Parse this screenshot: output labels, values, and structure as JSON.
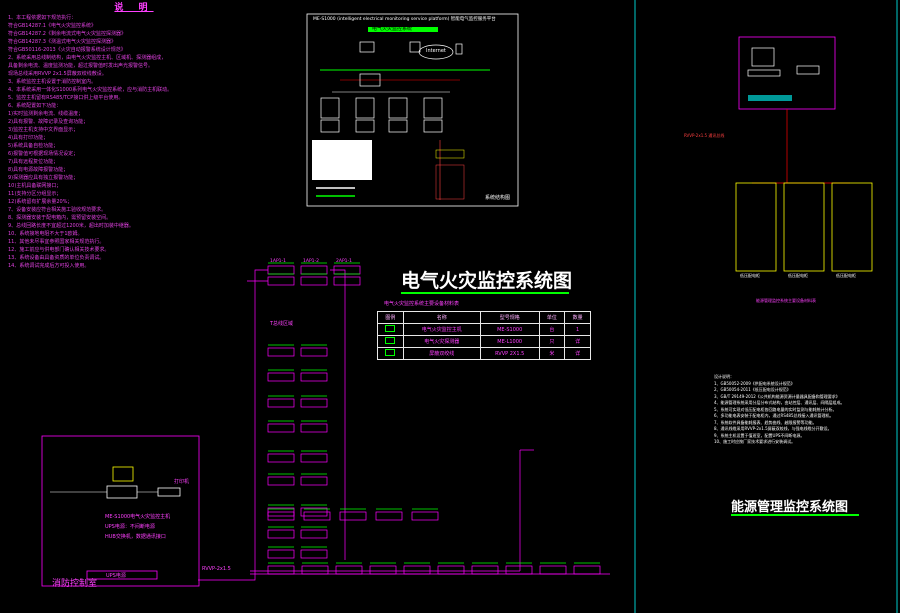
{
  "notes": {
    "title": "说 明",
    "lines": [
      "1、本工程依据如下规范执行：",
      "  符合GB14287.1《电气火灾监控系统》",
      "  符合GB14287.2《剩余电流式电气火灾监控探测器》",
      "  符合GB14287.3《测温式电气火灾监控探测器》",
      "  符合GB50116-2013《火灾自动报警系统设计规范》",
      "2、系统采用总线制结构，由电气火灾监控主机、区域机、探测器组成，",
      "  具备剩余电流、温度监测功能，超过报警值时发出声光报警信号。",
      "  现场总线采用RVVP 2x1.5屏蔽双绞线敷设。",
      "3、系统监控主机设置于消防控制室内。",
      "4、本系统采用一体化S1000系列电气火灾监控系统，应与消防主机联动。",
      "5、监控主机留有RS485/TCP接口供上级平台使用。",
      "6、系统配置如下功能：",
      "  1)实时监测剩余电流、线缆温度；",
      "  2)具有报警、故障记录及查询功能；",
      "  3)监控主机支持中文界面显示；",
      "  4)具有打印功能；",
      "  5)系统具备自检功能；",
      "  6)报警值可根据现场情况设定；",
      "  7)具有远程复位功能；",
      "  8)具有电源故障报警功能；",
      "  9)探测器应具有独立报警功能；",
      "  10)主机具备联网接口；",
      "  11)支持分区分组显示；",
      "  12)系统留有扩展余量20%；",
      "7、设备安装应符合相关施工验收规范要求。",
      "8、探测器安装于配电箱内，需预留安装空间。",
      "9、总线回路长度不宜超过1200米，超出时加装中继器。",
      "10、系统接地电阻不大于1欧姆。",
      "11、其他未尽事宜参照国家相关规范执行。",
      "12、施工前应与供电部门确认相关技术要求。",
      "13、系统设备由具备资质的单位负责调试。",
      "14、系统调试完成后方可投入使用。"
    ]
  },
  "titles": {
    "fire_monitor": "电气火灾监控系统图",
    "energy": "能源管理监控系统图"
  },
  "fire_legend": {
    "caption": "电气火灾监控系统主要设备材料表",
    "header": [
      "图例",
      "名称",
      "型号规格",
      "单位",
      "数量"
    ],
    "rows": [
      [
        "",
        "电气火灾监控主机",
        "ME-S1000",
        "台",
        "1"
      ],
      [
        "",
        "电气火灾探测器",
        "ME-L1000",
        "只",
        "详"
      ],
      [
        "",
        "屏蔽双绞线",
        "RVVP 2X1.5",
        "米",
        "详"
      ]
    ]
  },
  "control_room": {
    "label": "消防控制室",
    "printer": "打印机",
    "host_lines": [
      "ME-S1000电气火灾监控主机",
      "UPS电源：不间断电源",
      "HUB交换机，数据通讯接口"
    ],
    "bus": "RVVP-2x1.5",
    "ups": "UPS电源"
  },
  "network_panel": {
    "title": "ME-S1000 (intelligent electrical monitoring service platform) 智能电气监控服务平台",
    "subtitle": "电气火灾监控系统",
    "internet": "Internet",
    "footer": "系统结构图"
  },
  "bus_labels": {
    "sub_label": "T总线区域",
    "top_labels": [
      "1AP1-1",
      "1AP1-2",
      "2AP1-1"
    ]
  },
  "energy_panel": {
    "meter_table_title": "能源管理监控系统主要设备材料表",
    "link_label": "RVVP-2x1.5 通讯总线",
    "cabinet_labels": [
      "低压配电柜",
      "低压配电柜",
      "低压配电柜"
    ],
    "notes": [
      "设计说明：",
      "1、GB50052-2009《供配电系统设计规范》",
      "2、GB50054-2011《低压配电设计规范》",
      "3、GB/T 29149-2012《公共机构能源资源计量器具配备和管理要求》",
      "4、能源管理系统采用分层分布式结构，由站控层、通讯层、间隔层组成。",
      "5、系统可实现对低压配电柜各回路电量的实时监测与能耗统计分析。",
      "6、多功能电表安装于配电柜内，通过RS485总线接入通讯管理机。",
      "7、系统软件具备能耗报表、趋势曲线、越限报警等功能。",
      "8、通讯线缆采用RVVP-2x1.5屏蔽双绞线，与强电线缆分开敷设。",
      "9、系统主机设置于值班室，配置UPS不间断电源。",
      "10、施工时应按厂家技术要求进行安装调试。"
    ]
  },
  "colors": {
    "background": "#000000",
    "magenta": "#ff00ff",
    "green": "#00ff00",
    "cyan": "#00ffff",
    "yellow": "#ffff00",
    "white": "#ffffff"
  }
}
